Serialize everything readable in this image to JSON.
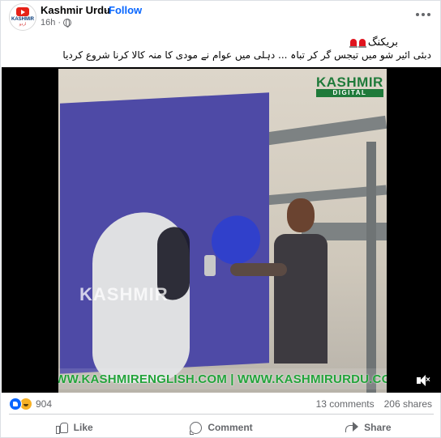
{
  "post": {
    "page_name": "Kashmir Urdu",
    "separator": "·",
    "follow_label": "Follow",
    "time": "16h",
    "separator2": "·",
    "privacy_icon": "globe-icon",
    "avatar": {
      "logo_text": "KASHMIR",
      "logo_sub": "اردو"
    }
  },
  "caption": {
    "line1": "بریکنگ",
    "line2": "دبئی ائیر شو میں تیجس گر کر تباہ ... دہلی میں عوام نے مودی کا منہ کالا کرنا شروع کردیا"
  },
  "video": {
    "brand_top": "KASHMIR",
    "brand_bottom": "DIGITAL",
    "watermark": "KASHMIR",
    "ticker": "WWW.KASHMIRENGLISH.COM | WWW.KASHMIRURDU.COM",
    "mute_icon": "volume-muted-icon"
  },
  "engagement": {
    "reaction_count": "904",
    "comments": "13 comments",
    "shares": "206 shares"
  },
  "actions": {
    "like": "Like",
    "comment": "Comment",
    "share": "Share"
  },
  "colors": {
    "link_blue": "#0866ff",
    "secondary_text": "#65676b",
    "ticker_green": "#22a33a",
    "board_purple": "#4e4aa6"
  }
}
